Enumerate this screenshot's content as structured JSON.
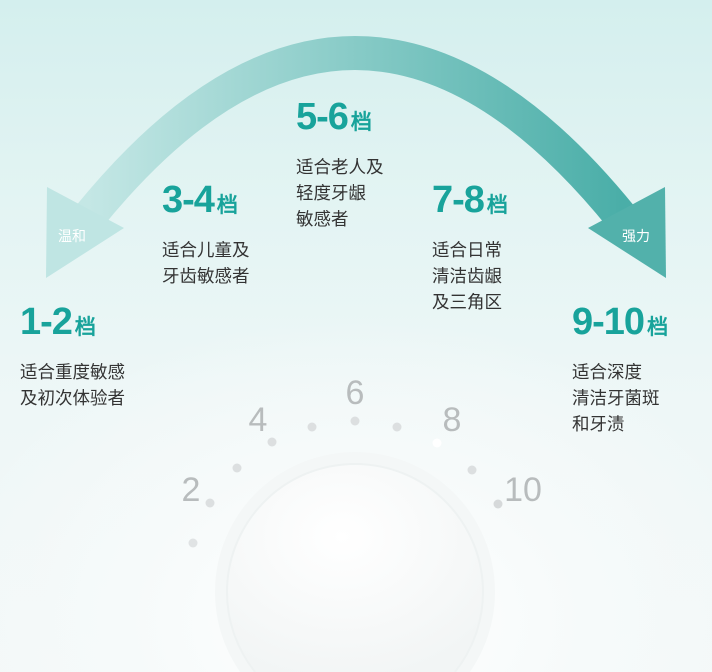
{
  "arrow": {
    "left_label": "温和",
    "right_label": "强力",
    "colors": {
      "start": "#c4e7e5",
      "end": "#4aaea8"
    }
  },
  "levels": [
    {
      "range": "1-2",
      "unit": "档",
      "desc": "适合重度敏感\n及初次体验者"
    },
    {
      "range": "3-4",
      "unit": "档",
      "desc": "适合儿童及\n牙齿敏感者"
    },
    {
      "range": "5-6",
      "unit": "档",
      "desc": "适合老人及\n轻度牙龈\n敏感者"
    },
    {
      "range": "7-8",
      "unit": "档",
      "desc": "适合日常\n清洁齿龈\n及三角区"
    },
    {
      "range": "9-10",
      "unit": "档",
      "desc": "适合深度\n清洁牙菌斑\n和牙渍"
    }
  ],
  "dial": {
    "labels": [
      "2",
      "4",
      "6",
      "8",
      "10"
    ],
    "current_level": 8
  },
  "colors": {
    "accent": "#18a39b",
    "text": "#333333"
  }
}
